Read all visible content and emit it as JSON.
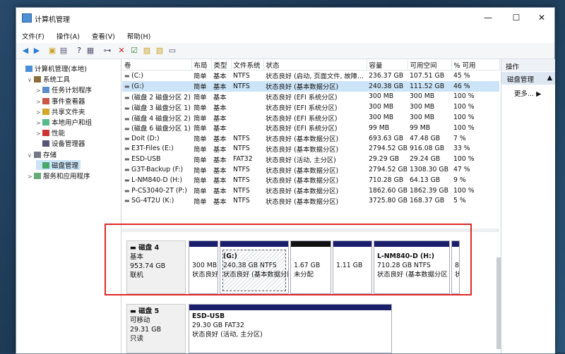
{
  "window": {
    "title": "计算机管理",
    "minimize": "—",
    "maximize": "☐",
    "close": "✕"
  },
  "menu": [
    "文件(F)",
    "操作(A)",
    "查看(V)",
    "帮助(H)"
  ],
  "tree": [
    {
      "label": "计算机管理(本地)",
      "indent": 0,
      "icon": "computer-icon"
    },
    {
      "label": "系统工具",
      "indent": 1,
      "icon": "tools-icon",
      "expander": "∨"
    },
    {
      "label": "任务计划程序",
      "indent": 2,
      "icon": "clock-icon",
      "expander": ">"
    },
    {
      "label": "事件查看器",
      "indent": 2,
      "icon": "event-icon",
      "expander": ">"
    },
    {
      "label": "共享文件夹",
      "indent": 2,
      "icon": "folder-icon",
      "expander": ">"
    },
    {
      "label": "本地用户和组",
      "indent": 2,
      "icon": "users-icon",
      "expander": ">"
    },
    {
      "label": "性能",
      "indent": 2,
      "icon": "performance-icon",
      "expander": ">"
    },
    {
      "label": "设备管理器",
      "indent": 2,
      "icon": "device-icon",
      "expander": ""
    },
    {
      "label": "存储",
      "indent": 1,
      "icon": "storage-icon",
      "expander": "∨"
    },
    {
      "label": "磁盘管理",
      "indent": 2,
      "icon": "disk-icon",
      "expander": "",
      "selected": true
    },
    {
      "label": "服务和应用程序",
      "indent": 1,
      "icon": "services-icon",
      "expander": ">"
    }
  ],
  "table": {
    "headers": [
      "卷",
      "布局",
      "类型",
      "文件系统",
      "状态",
      "容量",
      "可用空间",
      "% 可用"
    ],
    "rows": [
      [
        "(C:)",
        "简单",
        "基本",
        "NTFS",
        "状态良好 (启动, 页面文件, 故障...",
        "236.37 GB",
        "107.51 GB",
        "45 %"
      ],
      [
        "(G:)",
        "简单",
        "基本",
        "NTFS",
        "状态良好 (基本数据分区)",
        "240.38 GB",
        "111.52 GB",
        "46 %"
      ],
      [
        "(磁盘 2 磁盘分区 2)",
        "简单",
        "基本",
        "",
        "状态良好 (EFI 系统分区)",
        "300 MB",
        "300 MB",
        "100 %"
      ],
      [
        "(磁盘 3 磁盘分区 1)",
        "简单",
        "基本",
        "",
        "状态良好 (EFI 系统分区)",
        "300 MB",
        "300 MB",
        "100 %"
      ],
      [
        "(磁盘 4 磁盘分区 2)",
        "简单",
        "基本",
        "",
        "状态良好 (EFI 系统分区)",
        "300 MB",
        "300 MB",
        "100 %"
      ],
      [
        "(磁盘 6 磁盘分区 1)",
        "简单",
        "基本",
        "",
        "状态良好 (EFI 系统分区)",
        "99 MB",
        "99 MB",
        "100 %"
      ],
      [
        "Doit (D:)",
        "简单",
        "基本",
        "NTFS",
        "状态良好 (基本数据分区)",
        "693.63 GB",
        "47.48 GB",
        "7 %"
      ],
      [
        "E3T-Files (E:)",
        "简单",
        "基本",
        "NTFS",
        "状态良好 (基本数据分区)",
        "2794.52 GB",
        "916.08 GB",
        "33 %"
      ],
      [
        "ESD-USB",
        "简单",
        "基本",
        "FAT32",
        "状态良好 (活动, 主分区)",
        "29.29 GB",
        "29.24 GB",
        "100 %"
      ],
      [
        "G3T-Backup (F:)",
        "简单",
        "基本",
        "NTFS",
        "状态良好 (基本数据分区)",
        "2794.52 GB",
        "1308.30 GB",
        "47 %"
      ],
      [
        "L-NM840-D (H:)",
        "简单",
        "基本",
        "NTFS",
        "状态良好 (基本数据分区)",
        "710.28 GB",
        "64.13 GB",
        "9 %"
      ],
      [
        "P-CS3040-2T (P:)",
        "简单",
        "基本",
        "NTFS",
        "状态良好 (基本数据分区)",
        "1862.60 GB",
        "1862.39 GB",
        "100 %"
      ],
      [
        "SG-4T2U (K:)",
        "简单",
        "基本",
        "NTFS",
        "状态良好 (基本数据分区)",
        "3725.80 GB",
        "168.37 GB",
        "5 %"
      ]
    ]
  },
  "disk4": {
    "name": "磁盘 4",
    "type": "基本",
    "size": "953.74 GB",
    "status": "联机",
    "parts": [
      {
        "l1": "",
        "l2": "300 MB",
        "l3": "状态良好",
        "bar": "blue"
      },
      {
        "l1": "(G:)",
        "l2": "240.38 GB NTFS",
        "l3": "状态良好 (基本数据分区",
        "bar": "blue",
        "hatch": true
      },
      {
        "l1": "",
        "l2": "1.67 GB",
        "l3": "未分配",
        "bar": "black"
      },
      {
        "l1": "",
        "l2": "1.11 GB",
        "l3": "",
        "bar": "blue"
      },
      {
        "l1": "L-NM840-D (H:)",
        "l2": "710.28 GB NTFS",
        "l3": "状态良好 (基本数据分区",
        "bar": "blue"
      },
      {
        "l1": "",
        "l2": "8",
        "l3": "状",
        "bar": "blue"
      }
    ]
  },
  "disk5": {
    "name": "磁盘 5",
    "type": "可移动",
    "size": "29.31 GB",
    "status": "只读",
    "part": {
      "l1": "ESD-USB",
      "l2": "29.30 GB FAT32",
      "l3": "状态良好 (活动, 主分区)"
    }
  },
  "actions": {
    "header": "操作",
    "section": "磁盘管理",
    "more": "更多..."
  }
}
